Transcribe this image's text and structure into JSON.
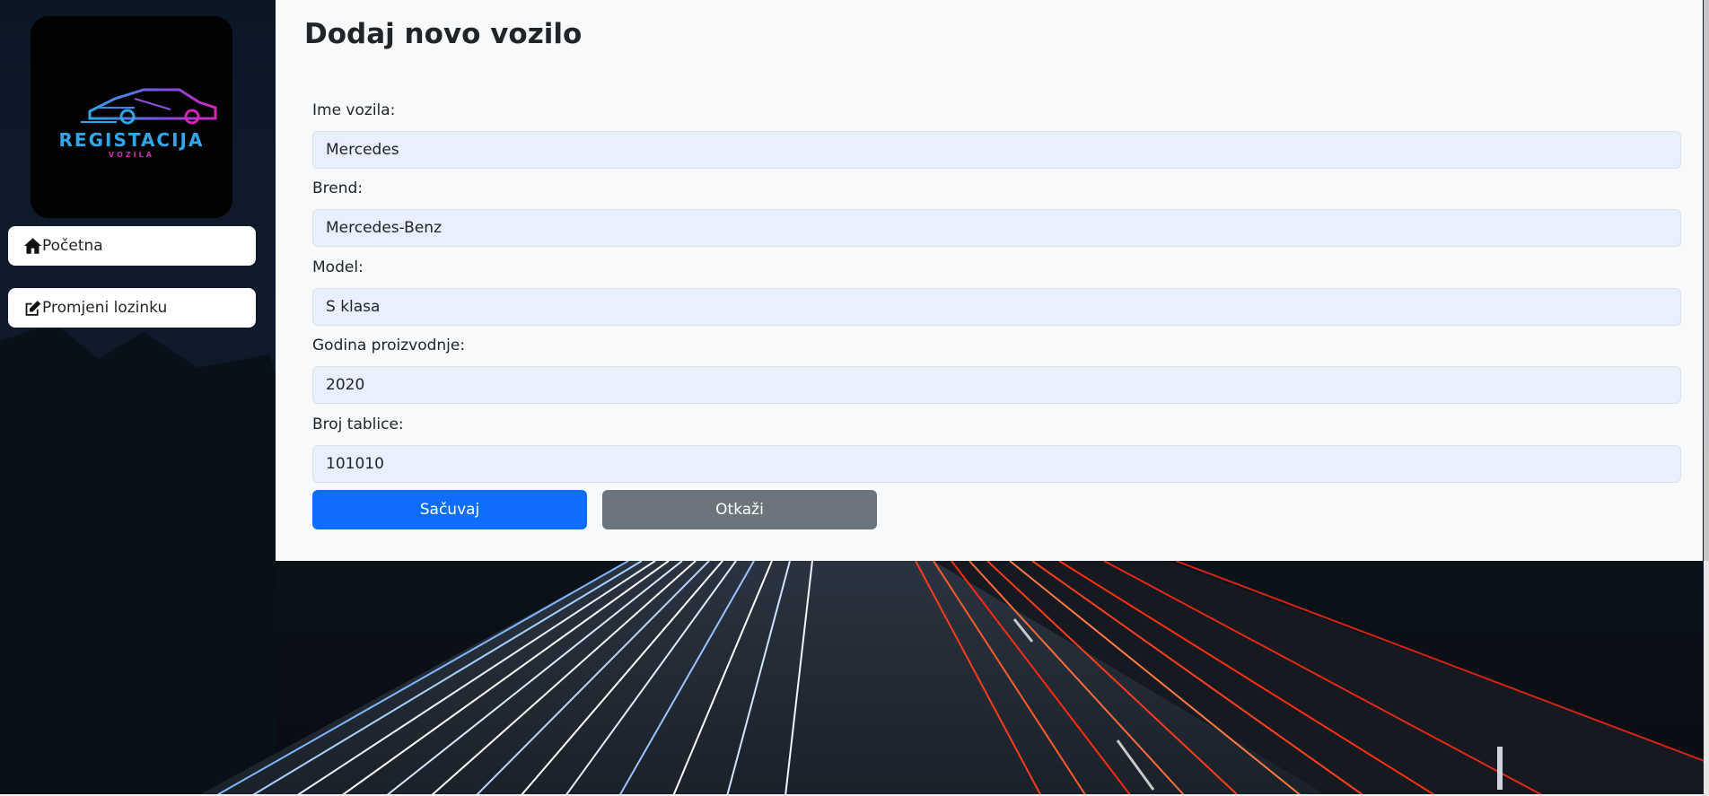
{
  "sidebar": {
    "logo": {
      "title": "REGISTACIJA",
      "subtitle": "VOZILA"
    },
    "nav": [
      {
        "label": "Početna",
        "icon": "home-icon"
      },
      {
        "label": "Promjeni lozinku",
        "icon": "edit-icon"
      }
    ]
  },
  "form": {
    "title": "Dodaj novo vozilo",
    "fields": [
      {
        "label": "Ime vozila:",
        "value": "Mercedes"
      },
      {
        "label": "Brend:",
        "value": "Mercedes-Benz"
      },
      {
        "label": "Model:",
        "value": "S klasa"
      },
      {
        "label": "Godina proizvodnje:",
        "value": "2020"
      },
      {
        "label": "Broj tablice:",
        "value": "101010"
      }
    ],
    "save_label": "Sačuvaj",
    "cancel_label": "Otkaži"
  },
  "colors": {
    "primary": "#0d6efd",
    "secondary": "#6c757d",
    "input_bg": "#e8f0fe",
    "panel_bg": "#f8f9fa"
  }
}
